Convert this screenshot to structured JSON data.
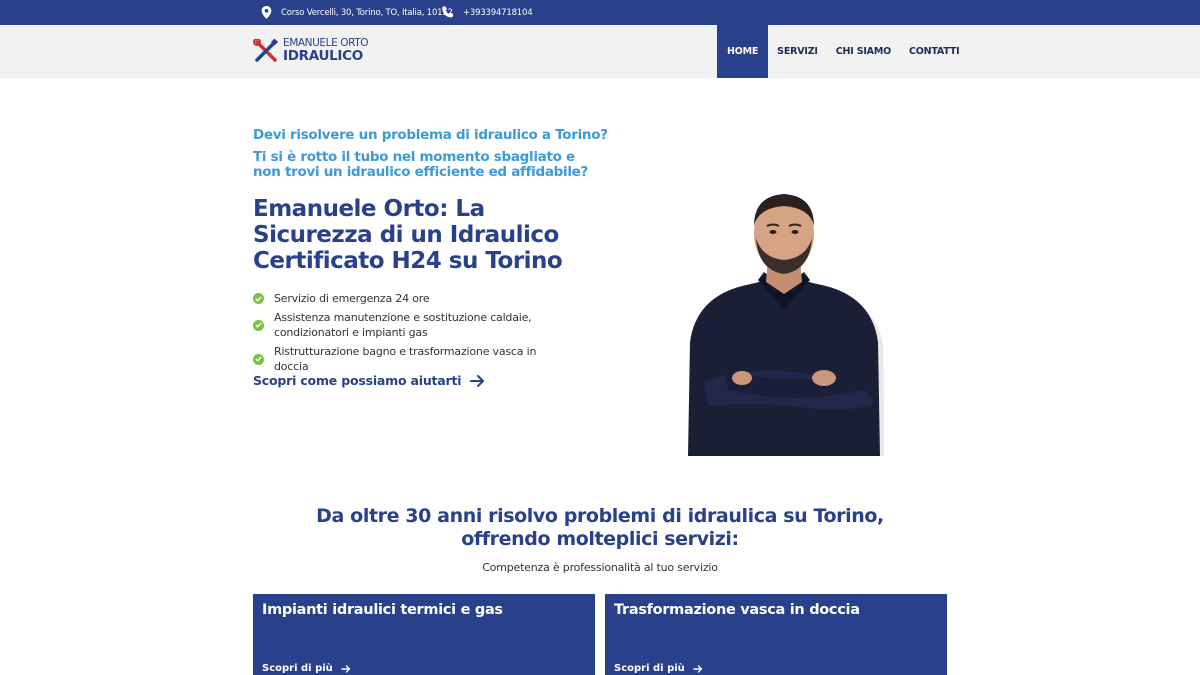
{
  "topbar": {
    "address": "Corso Vercelli, 30, Torino, TO, Italia, 10152",
    "phone": "+393394718104",
    "address_icon": "map-pin-icon",
    "phone_icon": "phone-icon"
  },
  "header": {
    "logo": {
      "line1": "EMANUELE ORTO",
      "line2": "IDRAULICO",
      "icon": "wrench-screwdriver-icon"
    },
    "nav": [
      {
        "label": "HOME",
        "active": true
      },
      {
        "label": "SERVIZI",
        "active": false
      },
      {
        "label": "CHI SIAMO",
        "active": false
      },
      {
        "label": "CONTATTI",
        "active": false
      }
    ]
  },
  "hero": {
    "question1": "Devi risolvere un problema di idraulico a Torino?",
    "question2": "Ti si è rotto il tubo nel momento sbagliato e non trovi un idraulico efficiente ed affidabile?",
    "title": "Emanuele Orto: La Sicurezza di un Idraulico Certificato H24 su Torino",
    "features": [
      "Servizio di emergenza 24 ore",
      "Assistenza manutenzione e sostituzione caldaie, condizionatori e impianti gas",
      "Ristrutturazione bagno e trasformazione vasca in doccia"
    ],
    "cta": "Scopri come possiamo aiutarti"
  },
  "services": {
    "title": "Da oltre 30 anni risolvo problemi di idraulica su Torino, offrendo molteplici servizi:",
    "subtitle": "Competenza è professionalità al tuo servizio",
    "cards": [
      {
        "title": "Impianti idraulici termici e gas",
        "link": "Scopri di più"
      },
      {
        "title": "Trasformazione vasca in doccia",
        "link": "Scopri di più"
      }
    ]
  },
  "colors": {
    "brand_blue": "#28418a",
    "accent_blue": "#3e9ad6",
    "check_green": "#7bc043",
    "logo_red": "#d32f2f"
  }
}
